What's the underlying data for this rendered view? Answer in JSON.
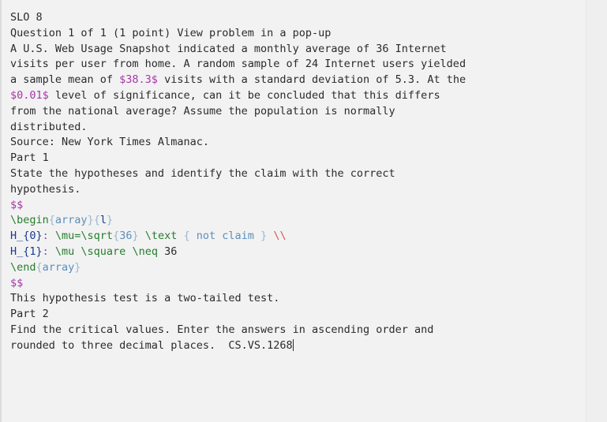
{
  "editor": {
    "background_color": "#f2f2f3",
    "text_color": "#2b2b2b",
    "colors": {
      "math_delimiter": "#a637a6",
      "latex_command": "#267d2b",
      "latex_argument": "#5b8fb9",
      "brace": "#9bb7cc",
      "identifier": "#1a3a8f",
      "colon": "#7b4fa8",
      "newline_command": "#d9534f"
    }
  },
  "document": {
    "line_01": "SLO 8",
    "line_02": "Question 1 of 1 (1 point) View problem in a pop-up",
    "line_03": "A U.S. Web Usage Snapshot indicated a monthly average of 36 Internet",
    "line_04": "visits per user from home. A random sample of 24 Internet users yielded",
    "line_05_a": "a sample mean of ",
    "line_05_b": "$38.3$",
    "line_05_c": " visits with a standard deviation of 5.3. At the",
    "line_06_a": "$0.01$",
    "line_06_b": " level of significance, can it be concluded that this differs",
    "line_07": "from the national average? Assume the population is normally",
    "line_08": "distributed.",
    "line_09": "Source: New York Times Almanac.",
    "line_10": "Part 1",
    "line_11": "State the hypotheses and identify the claim with the correct",
    "line_12": "hypothesis.",
    "line_13": "$$",
    "line_14_cmd": "\\begin",
    "line_14_ob1": "{",
    "line_14_arg1": "array",
    "line_14_cb1": "}",
    "line_14_ob2": "{",
    "line_14_arg2": "l",
    "line_14_cb2": "}",
    "line_15_ident": "H_{0}",
    "line_15_colon": ":",
    "line_15_cmd1": " \\mu=\\sqrt",
    "line_15_ob1": "{",
    "line_15_arg1": "36",
    "line_15_cb1": "}",
    "line_15_cmd2": " \\text",
    "line_15_ob2": " {",
    "line_15_arg2": " not claim ",
    "line_15_cb2": "}",
    "line_15_nl": " \\\\",
    "line_16_ident": "H_{1}",
    "line_16_colon": ":",
    "line_16_cmd": " \\mu \\square \\neq",
    "line_16_num": " 36",
    "line_17_cmd": "\\end",
    "line_17_ob": "{",
    "line_17_arg": "array",
    "line_17_cb": "}",
    "line_18": "$$",
    "line_19": "This hypothesis test is a two-tailed test.",
    "line_20": "Part 2",
    "line_21": "Find the critical values. Enter the answers in ascending order and",
    "line_22_a": "rounded to three decimal places.  ",
    "line_22_b": "CS.VS.1268"
  }
}
